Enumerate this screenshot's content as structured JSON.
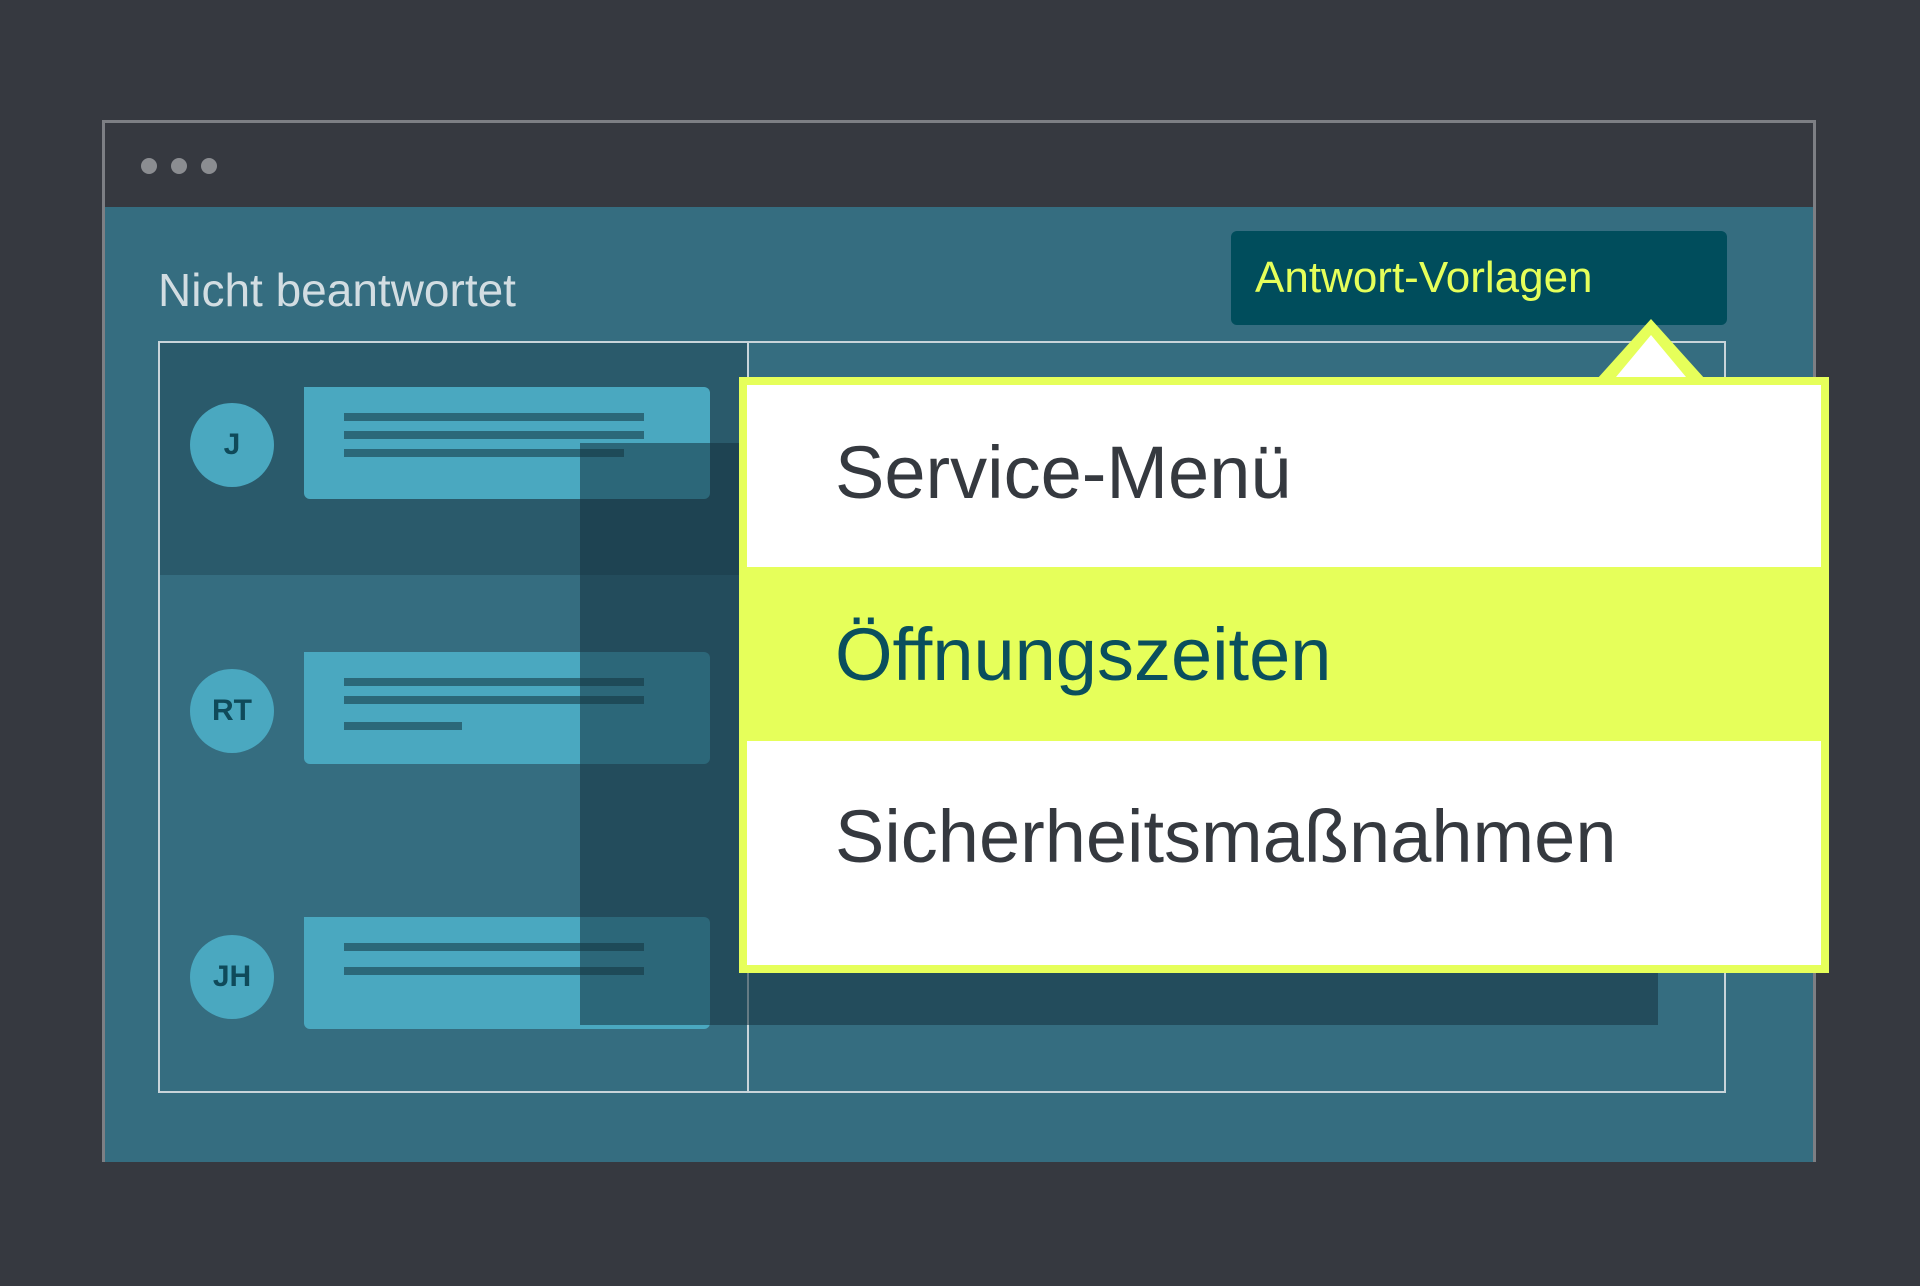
{
  "window": {
    "title_dots": [
      "dot-1",
      "dot-2",
      "dot-3"
    ]
  },
  "inbox": {
    "section_title": "Nicht beantwortet",
    "conversations": [
      {
        "initials": "J"
      },
      {
        "initials": "RT"
      },
      {
        "initials": "JH"
      }
    ]
  },
  "templates": {
    "button_label": "Antwort-Vorlagen",
    "items": [
      {
        "label": "Service-Menü",
        "active": false
      },
      {
        "label": "Öffnungszeiten",
        "active": true
      },
      {
        "label": "Sicherheitsmaßnahmen",
        "active": false
      }
    ]
  },
  "colors": {
    "background": "#363940",
    "window_body": "#356d80",
    "accent": "#e6ff5a",
    "button_bg": "#004d5c",
    "avatar": "#4aa8c0"
  }
}
